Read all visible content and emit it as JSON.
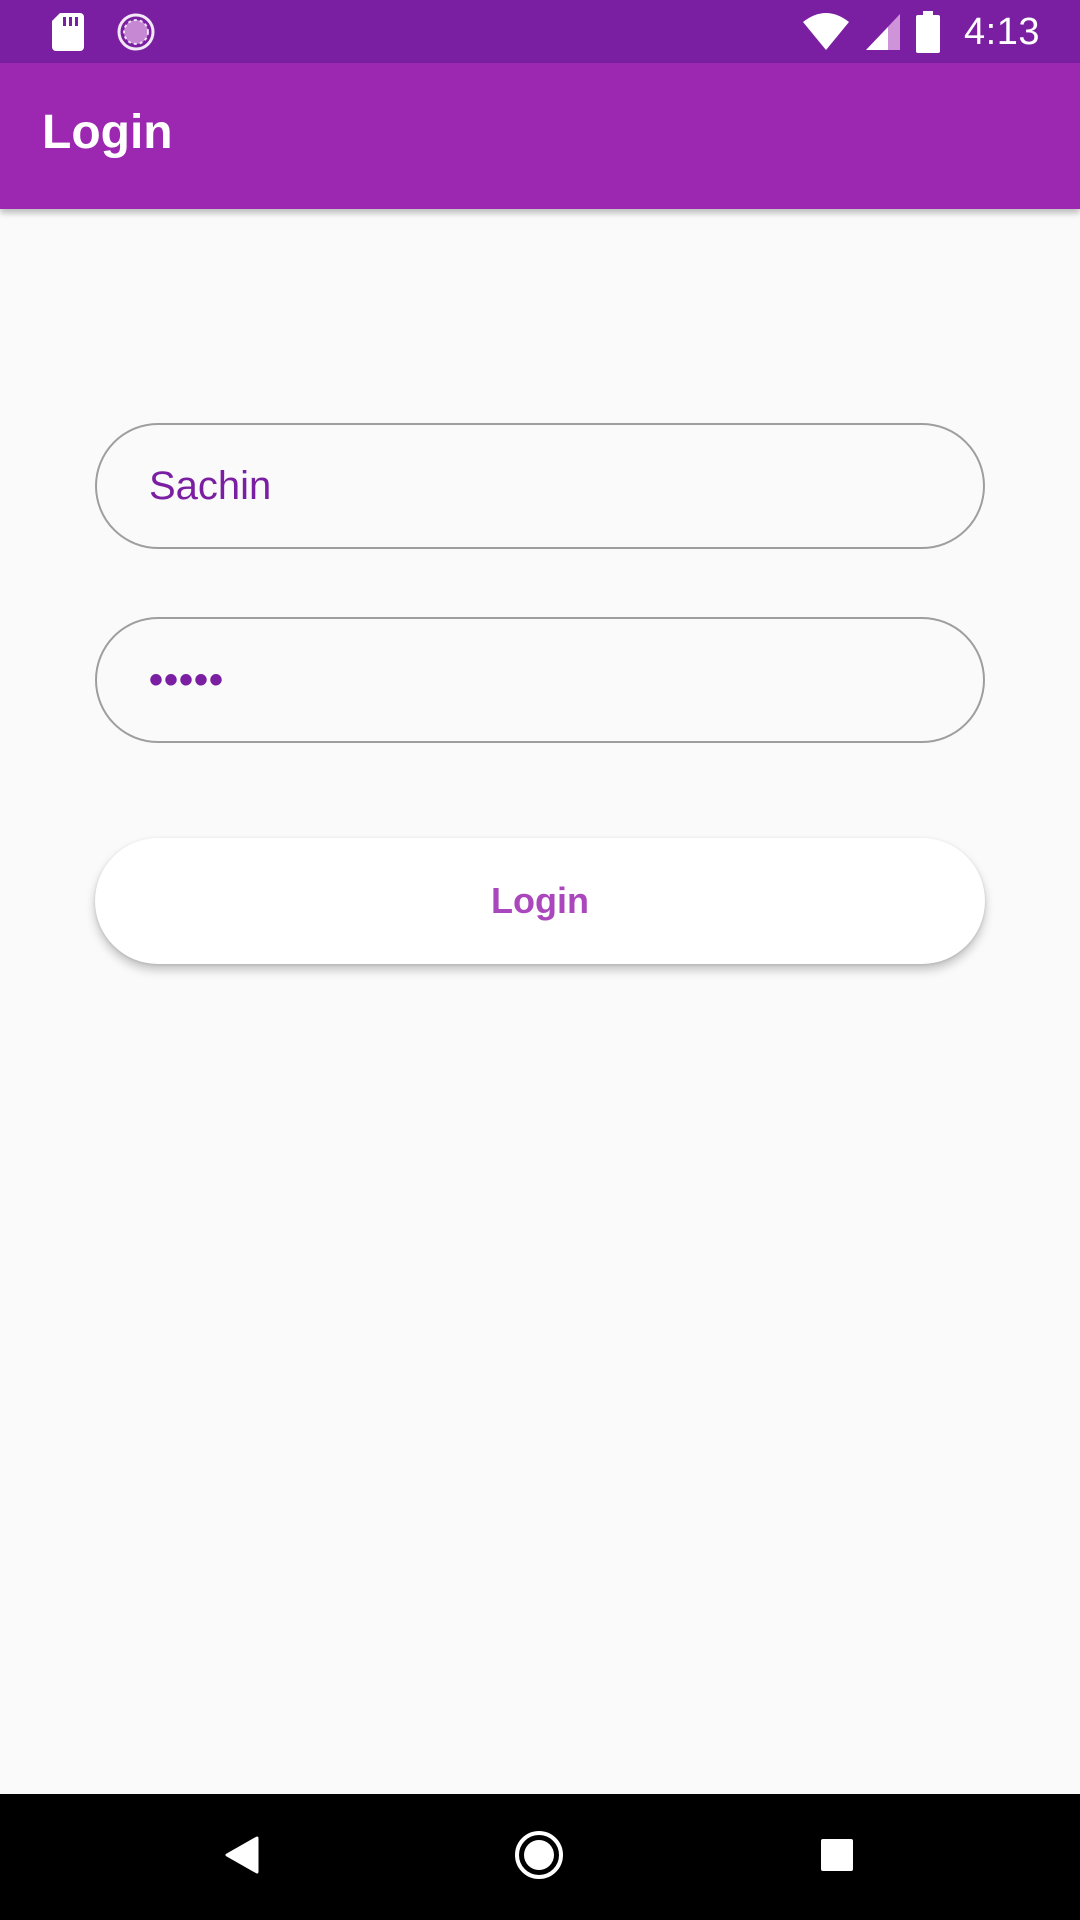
{
  "status_bar": {
    "time": "4:13",
    "icons": [
      "sd-card-icon",
      "sync-icon",
      "wifi-icon",
      "signal-icon",
      "battery-icon"
    ]
  },
  "app_bar": {
    "title": "Login"
  },
  "form": {
    "username_value": "Sachin",
    "password_value": "•••••",
    "login_button_label": "Login"
  },
  "nav_bar": {
    "icons": [
      "back-icon",
      "home-icon",
      "recents-icon"
    ]
  },
  "colors": {
    "status_bar": "#7b1fa2",
    "app_bar": "#9c27b0",
    "accent_text": "#7b1fa2",
    "button_text": "#ab47bc",
    "background": "#fafafa"
  }
}
